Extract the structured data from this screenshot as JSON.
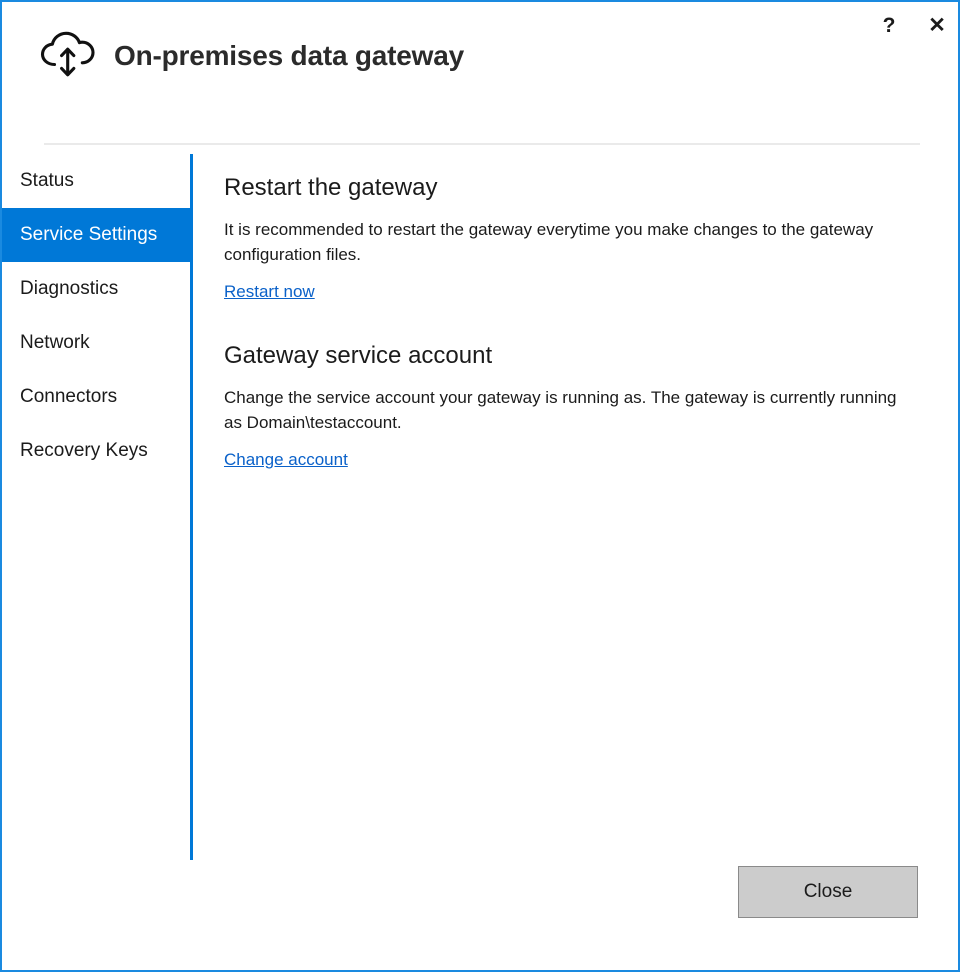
{
  "window": {
    "title": "On-premises data gateway",
    "brand_icon": "cloud-updown-arrow-icon",
    "accent_color": "#0078d7",
    "border_color": "#1a8ae0"
  },
  "caption": {
    "help_label": "?",
    "help_icon": "question-mark-icon",
    "close_label": "✕",
    "close_icon": "close-x-icon"
  },
  "sidebar": {
    "items": [
      {
        "label": "Status",
        "selected": false
      },
      {
        "label": "Service Settings",
        "selected": true
      },
      {
        "label": "Diagnostics",
        "selected": false
      },
      {
        "label": "Network",
        "selected": false
      },
      {
        "label": "Connectors",
        "selected": false
      },
      {
        "label": "Recovery Keys",
        "selected": false
      }
    ]
  },
  "content": {
    "sections": [
      {
        "title": "Restart the gateway",
        "description": "It is recommended to restart the gateway everytime you make changes to the gateway configuration files.",
        "link": "Restart now"
      },
      {
        "title": "Gateway service account",
        "description": "Change the service account your gateway is running as. The gateway is currently running as Domain\\testaccount.",
        "link": "Change account"
      }
    ]
  },
  "footer": {
    "close_label": "Close"
  }
}
